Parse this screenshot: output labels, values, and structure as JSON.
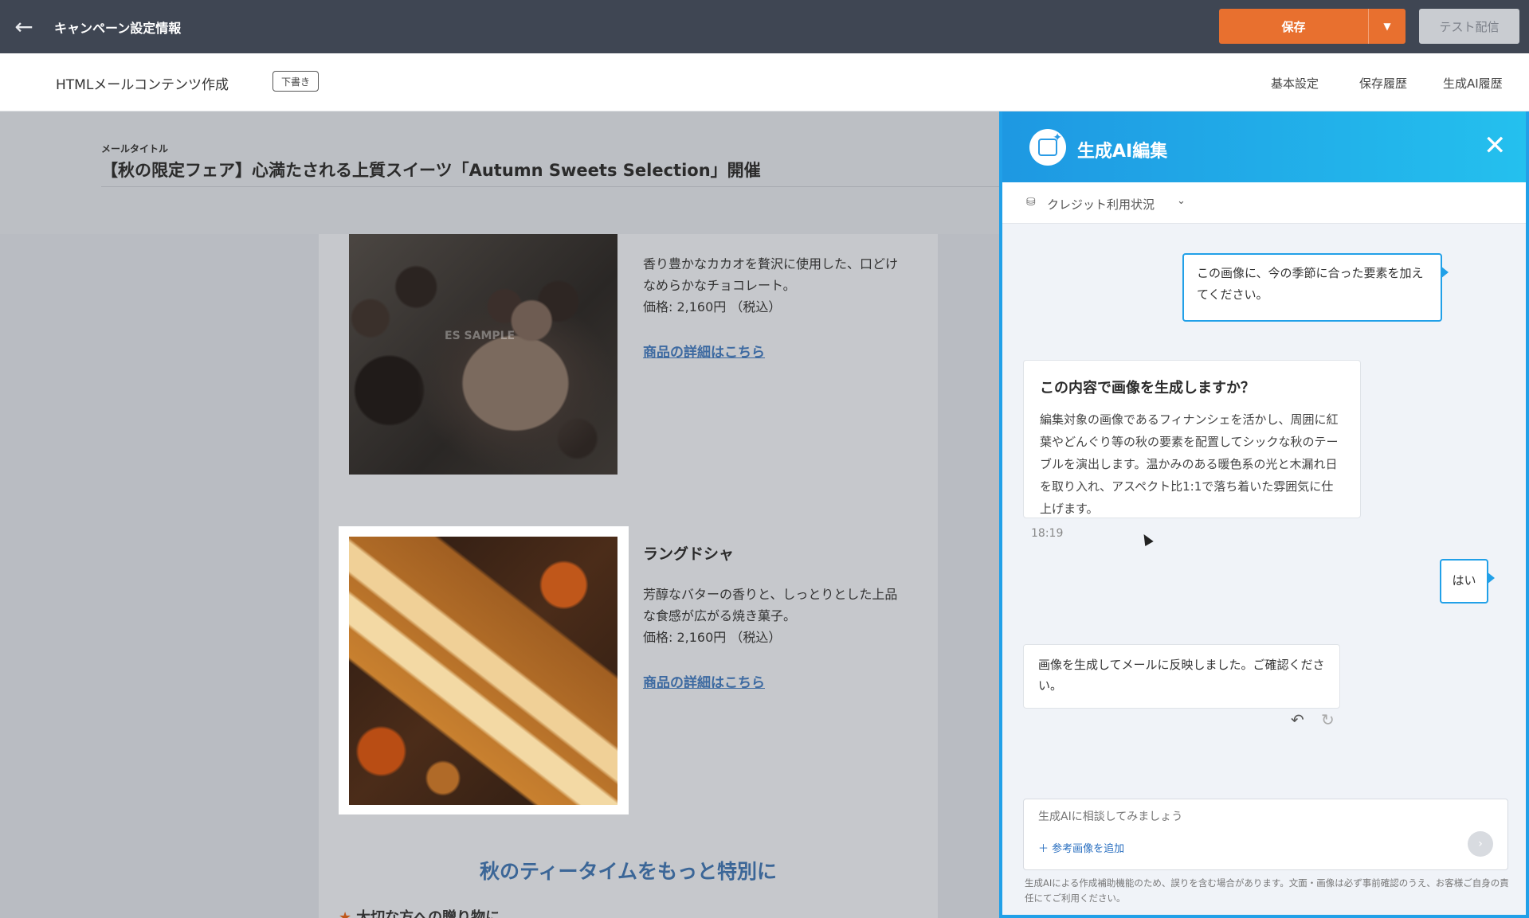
{
  "topbar": {
    "back_icon": "arrow-left-icon",
    "title": "キャンペーン設定情報",
    "save_label": "保存",
    "save_caret": "▼",
    "test_send_label": "テスト配信"
  },
  "subheader": {
    "title": "HTMLメールコンテンツ作成",
    "badge": "下書き",
    "nav": [
      "基本設定",
      "保存履歴",
      "生成AI履歴"
    ]
  },
  "editor": {
    "mail_title_label": "メールタイトル",
    "mail_title": "【秋の限定フェア】心満たされる上質スイーツ「Autumn Sweets Selection」開催",
    "products": [
      {
        "name": "",
        "description": "香り豊かなカカオを贅沢に使用した、口どけなめらかなチョコレート。",
        "price": "価格: 2,160円 （税込）",
        "link": "商品の詳細はこちら",
        "watermark": "ES SAMPLE"
      },
      {
        "name": "ラングドシャ",
        "description": "芳醇なバターの香りと、しっとりとした上品な食感が広がる焼き菓子。",
        "price": "価格: 2,160円 （税込）",
        "link": "商品の詳細はこちら"
      }
    ],
    "section_heading": "秋のティータイムをもっと特別に",
    "gift_line": "大切な方への贈り物に"
  },
  "ai_panel": {
    "title": "生成AI編集",
    "close_icon": "close-icon",
    "credit_label": "クレジット利用状況",
    "messages": {
      "user1": "この画像に、今の季節に合った要素を加えてください。",
      "ai_confirm_title": "この内容で画像を生成しますか？",
      "ai_confirm_body": "編集対象の画像であるフィナンシェを活かし、周囲に紅葉やどんぐり等の秋の要素を配置してシックな秋のテーブルを演出します。温かみのある暖色系の光と木漏れ日を取り入れ、アスペクト比1:1で落ち着いた雰囲気に仕上げます。",
      "timestamp": "18:19",
      "user2": "はい",
      "ai_done": "画像を生成してメールに反映しました。ご確認ください。"
    },
    "input_placeholder": "生成AIに相談してみましょう",
    "add_reference": "＋ 参考画像を追加",
    "disclaimer": "生成AIによる作成補助機能のため、誤りを含む場合があります。文面・画像は必ず事前確認のうえ、お客様ご自身の責任にてご利用ください。"
  },
  "colors": {
    "topbar_bg": "#3f4653",
    "save_orange": "#e8702f",
    "ai_blue": "#21a0e8",
    "link_blue": "#3d6aa1"
  }
}
